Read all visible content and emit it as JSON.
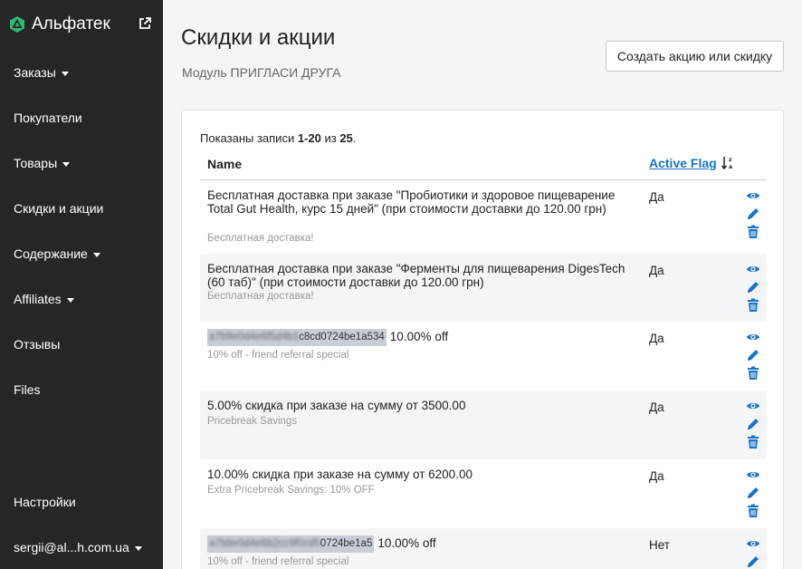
{
  "sidebar": {
    "brand": "Альфатек",
    "items": [
      {
        "label": "Заказы",
        "caret": true
      },
      {
        "label": "Покупатели",
        "caret": false
      },
      {
        "label": "Товары",
        "caret": true
      },
      {
        "label": "Скидки и акции",
        "caret": false
      },
      {
        "label": "Содержание",
        "caret": true
      },
      {
        "label": "Affiliates",
        "caret": true
      },
      {
        "label": "Отзывы",
        "caret": false
      },
      {
        "label": "Files",
        "caret": false
      }
    ],
    "settings": "Настройки",
    "user": "sergii@al...h.com.ua"
  },
  "header": {
    "title": "Скидки и акции",
    "subtitle": "Модуль ПРИГЛАСИ ДРУГА",
    "create_button": "Создать акцию или скидку"
  },
  "table": {
    "summary_prefix": "Показаны записи ",
    "summary_range": "1-20",
    "summary_mid": " из ",
    "summary_total": "25",
    "summary_suffix": ".",
    "col_name": "Name",
    "col_flag": "Active Flag",
    "rows": [
      {
        "code": "",
        "title": "Бесплатная доставка при заказе \"Пробиотики и здоровое пищеварение Total Gut Health, курс 15 дней\" (при стоимости доставки до 120.00 грн)",
        "desc": "Бесплатная доставка!",
        "flag": "Да"
      },
      {
        "code": "",
        "title": "Бесплатная доставка при заказе \"Ферменты для пищеварения DigesTech (60 таб)\" (при стоимости доставки до 120.00 грн)",
        "desc": "Бесплатная доставка!",
        "flag": "Да"
      },
      {
        "code_blur": "a7b9e0d4e6f5d4b1",
        "code": "c8cd0724be1a534",
        "title": "10.00% off",
        "desc": "10% off - friend referral special",
        "flag": "Да"
      },
      {
        "code": "",
        "title": "5.00% скидка при заказе на сумму от 3500.00",
        "desc": "Pricebreak Savings",
        "flag": "Да"
      },
      {
        "code": "",
        "title": "10.00% скидка при заказе на сумму от 6200.00",
        "desc": "Extra Pricebreak Savings: 10% OFF",
        "flag": "Да"
      },
      {
        "code_blur": "a7b9e0d4e6b2cc9f0cd5",
        "code": "0724be1a5",
        "title": "10.00% off",
        "desc": "10% off - friend referral special",
        "flag": "Нет"
      }
    ]
  },
  "colors": {
    "sidebar_bg": "#262626",
    "brand_green": "#2eb872",
    "link_blue": "#1a73c7",
    "stripe": "#f4f5f6"
  },
  "icons": {
    "view": "eye-icon",
    "edit": "pencil-icon",
    "delete": "trash-icon",
    "sort": "sort-desc-icon",
    "external": "external-link-icon"
  }
}
